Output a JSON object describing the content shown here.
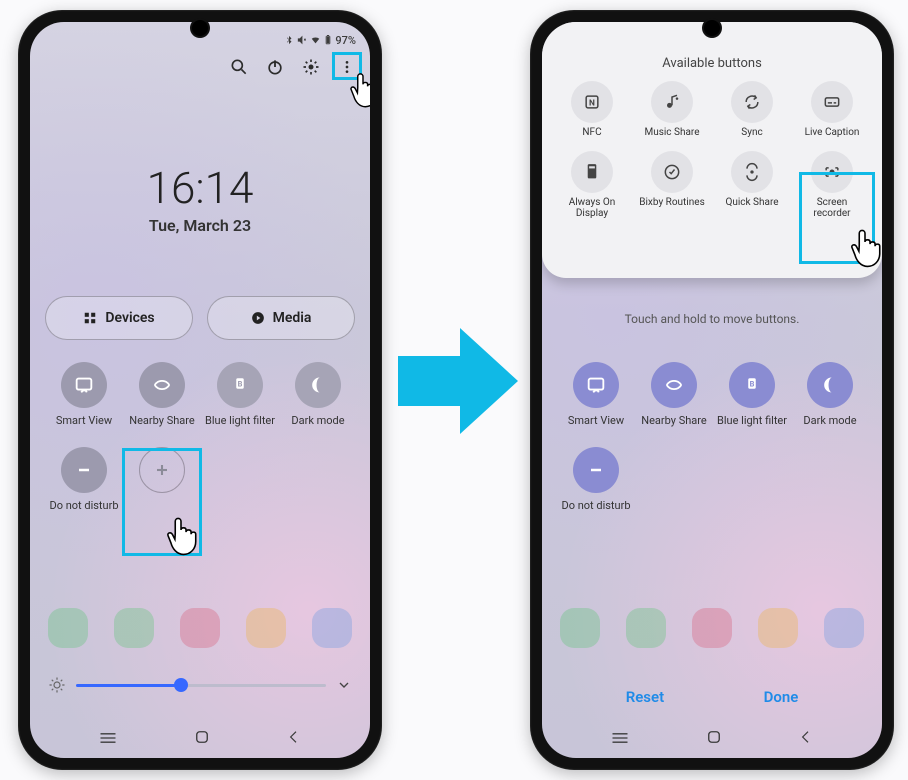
{
  "status": {
    "battery_pct": "97%"
  },
  "top_icons": {
    "search": "search",
    "power": "power",
    "settings": "settings",
    "more": "more"
  },
  "clock": {
    "time": "16:14",
    "date": "Tue, March 23"
  },
  "pills": {
    "devices": "Devices",
    "media": "Media"
  },
  "left_tiles": {
    "smart_view": "Smart View",
    "nearby_share": "Nearby Share",
    "blue_light": "Blue light filter",
    "dark_mode": "Dark mode",
    "dnd": "Do not disturb"
  },
  "sheet": {
    "title": "Available buttons",
    "nfc": "NFC",
    "music_share": "Music Share",
    "sync": "Sync",
    "live_caption": "Live Caption",
    "aod": "Always On Display",
    "bixby": "Bixby Routines",
    "quick_share": "Quick Share",
    "screen_recorder": "Screen recorder"
  },
  "hint": "Touch and hold to move buttons.",
  "right_tiles": {
    "smart_view": "Smart View",
    "nearby_share": "Nearby Share",
    "blue_light": "Blue light filter",
    "dark_mode": "Dark mode",
    "dnd": "Do not disturb"
  },
  "actions": {
    "reset": "Reset",
    "done": "Done"
  },
  "colors": {
    "highlight": "#10b9e6",
    "tile_blue": "#8a8cd2",
    "action_blue": "#1f8be8"
  }
}
